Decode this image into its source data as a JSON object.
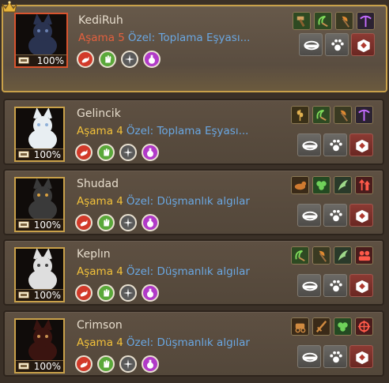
{
  "pets": [
    {
      "name": "KediRuh",
      "stage_label": "Aşama 5",
      "special": "Özel: Toplama Eşyası...",
      "percent": "100%",
      "selected": true,
      "skills": [
        "hammer-icon",
        "sickle-icon",
        "axe-icon",
        "pickaxe-icon"
      ]
    },
    {
      "name": "Gelincik",
      "stage_label": "Aşama 4",
      "special": "Özel: Toplama Eşyası...",
      "percent": "100%",
      "selected": false,
      "skills": [
        "wheat-icon",
        "sickle-icon",
        "axe-icon",
        "pickaxe-icon"
      ]
    },
    {
      "name": "Shudad",
      "stage_label": "Aşama 4",
      "special": "Özel: Düşmanlık algılar",
      "percent": "100%",
      "selected": false,
      "skills": [
        "pet-icon",
        "clover-icon",
        "wing-icon",
        "arrow-up-icon"
      ]
    },
    {
      "name": "Keplın",
      "stage_label": "Aşama 4",
      "special": "Özel: Düşmanlık algılar",
      "percent": "100%",
      "selected": false,
      "skills": [
        "sickle-icon",
        "axe-icon",
        "wing-icon",
        "group-icon"
      ]
    },
    {
      "name": "Crimson",
      "stage_label": "Aşama 4",
      "special": "Özel: Düşmanlık algılar",
      "percent": "100%",
      "selected": false,
      "skills": [
        "carriage-icon",
        "sword-icon",
        "clover-icon",
        "target-icon"
      ]
    }
  ],
  "stat_icons": [
    "speed-icon",
    "hand-icon",
    "sparkle-icon",
    "potion-icon"
  ],
  "action_icons": [
    "feed-bowl-icon",
    "paw-icon",
    "release-icon"
  ],
  "colors": {
    "gold": "#f2c13a",
    "selected_stage": "#e3603e",
    "special": "#6aa7e2",
    "name": "#e6dccc",
    "border_gold": "#c9a14a",
    "selected_portrait": "#d9542e"
  }
}
